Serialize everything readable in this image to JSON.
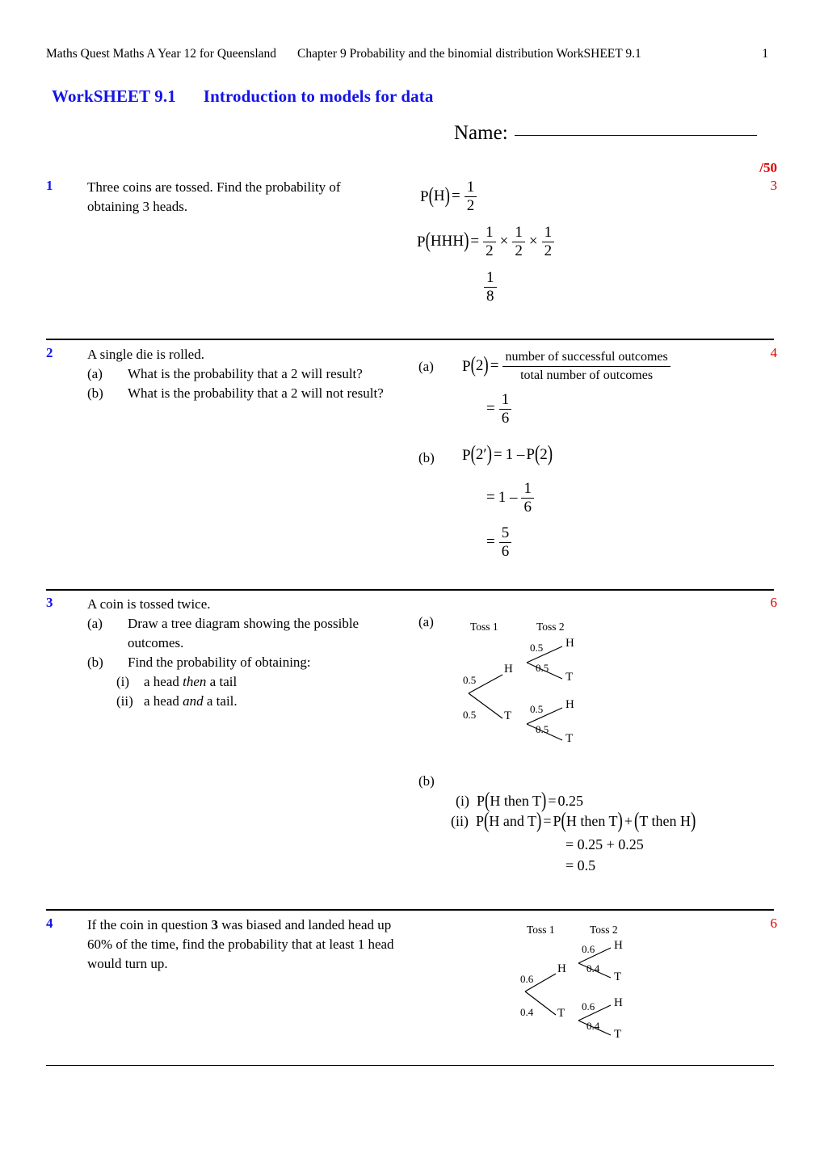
{
  "header": {
    "book": "Maths Quest Maths A Year 12 for Queensland",
    "chapter": "Chapter 9  Probability and the binomial distribution  WorkSHEET 9.1",
    "page_number": "1"
  },
  "title": {
    "worksheet_label": "WorkSHEET 9.1",
    "worksheet_name": "Introduction to models for data"
  },
  "name_field": {
    "label": "Name:",
    "value": ""
  },
  "total_marks": "/50",
  "questions": [
    {
      "number": "1",
      "mark": "3",
      "text": "Three coins are tossed. Find the probability of obtaining 3 heads.",
      "answer": {
        "line1_lhs": "P",
        "line1_arg": "H",
        "line1_eq": "=",
        "line1_num": "1",
        "line1_den": "2",
        "line2_lhs": "P",
        "line2_arg": "HHH",
        "line2_eq": "=",
        "line2_f1_num": "1",
        "line2_f1_den": "2",
        "line2_op1": "×",
        "line2_f2_num": "1",
        "line2_f2_den": "2",
        "line2_op2": "×",
        "line2_f3_num": "1",
        "line2_f3_den": "2",
        "line3_num": "1",
        "line3_den": "8"
      }
    },
    {
      "number": "2",
      "mark": "4",
      "stem": "A single die is rolled.",
      "parts": [
        {
          "label": "(a)",
          "text": "What is the probability that a 2 will result?"
        },
        {
          "label": "(b)",
          "text": "What is the probability that a 2 will not result?"
        }
      ],
      "answer": {
        "a_label": "(a)",
        "a_lhs": "P",
        "a_arg": "2",
        "a_eq": "=",
        "a_num": "number of successful  outcomes",
        "a_den": "total number of outcomes",
        "a2_eq": "=",
        "a2_num": "1",
        "a2_den": "6",
        "b_label": "(b)",
        "b_lhs": "P",
        "b_arg": "2′",
        "b_eq": "=",
        "b_rhs_pre": "1 –",
        "b_rhs_p": "P",
        "b_rhs_arg": "2",
        "b2_eq": "=",
        "b2_one": "1 –",
        "b2_num": "1",
        "b2_den": "6",
        "b3_eq": "=",
        "b3_num": "5",
        "b3_den": "6"
      }
    },
    {
      "number": "3",
      "mark": "6",
      "stem": "A coin is tossed twice.",
      "parts": [
        {
          "label": "(a)",
          "text": "Draw a tree diagram showing the possible outcomes."
        },
        {
          "label": "(b)",
          "text": "Find the probability of obtaining:"
        }
      ],
      "subparts": [
        {
          "label": "(i)",
          "pre": "a head ",
          "em": "then",
          "post": " a tail"
        },
        {
          "label": "(ii)",
          "pre": "a head ",
          "em": "and",
          "post": " a tail."
        }
      ],
      "answer": {
        "a_label": "(a)",
        "tree": {
          "head1": "Toss 1",
          "head2": "Toss 2",
          "p_h1": "0.5",
          "p_t1": "0.5",
          "node_h1": "H",
          "node_t1": "T",
          "p_hh": "0.5",
          "p_ht": "0.5",
          "p_th": "0.5",
          "p_tt": "0.5",
          "node_hh": "H",
          "node_ht": "T",
          "node_th": "H",
          "node_tt": "T"
        },
        "b_label": "(b)",
        "i_label": "(i)",
        "i_p": "P",
        "i_arg": "H then T",
        "i_eq": "=",
        "i_val": "0.25",
        "ii_label": "(ii)",
        "ii_p": "P",
        "ii_arg": "H and T",
        "ii_eq": "=",
        "ii_p2": "P",
        "ii_arg2": "H then T",
        "ii_plus": "+",
        "ii_arg3": "T then H",
        "ii_line2": "= 0.25 + 0.25",
        "ii_line3": "= 0.5"
      }
    },
    {
      "number": "4",
      "mark": "6",
      "text_pre": "If the coin in question ",
      "text_bold": "3",
      "text_post": " was biased and landed head up 60% of the time, find the probability that at least 1 head would turn up.",
      "answer": {
        "tree": {
          "head1": "Toss 1",
          "head2": "Toss 2",
          "p_h1": "0.6",
          "p_t1": "0.4",
          "node_h1": "H",
          "node_t1": "T",
          "p_hh": "0.6",
          "p_ht": "0.4",
          "p_th": "0.6",
          "p_tt": "0.4",
          "node_hh": "H",
          "node_ht": "T",
          "node_th": "H",
          "node_tt": "T"
        }
      }
    }
  ],
  "colors": {
    "heading_blue": "#1414e6",
    "mark_red": "#e00000",
    "rule_black": "#000000"
  }
}
